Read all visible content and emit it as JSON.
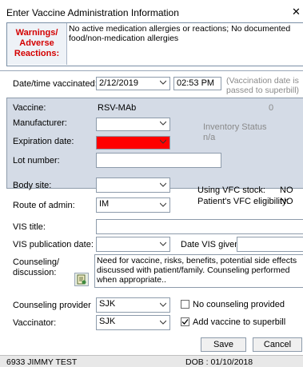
{
  "window": {
    "title": "Enter Vaccine Administration Information",
    "close": "✕"
  },
  "warnings": {
    "label": "Warnings/ Adverse Reactions:",
    "text": "No active medication allergies or reactions; No documented food/non-medication allergies"
  },
  "datetime": {
    "label": "Date/time vaccinated:",
    "date": "2/12/2019",
    "time": "02:53 PM",
    "note": "(Vaccination date is passed to superbill)"
  },
  "vaccine": {
    "label": "Vaccine:",
    "value": "RSV-MAb",
    "count": "0",
    "manufacturer_label": "Manufacturer:",
    "manufacturer": "",
    "expiration_label": "Expiration date:",
    "expiration": "",
    "inventory_label": "Inventory Status",
    "inventory_value": "n/a",
    "lot_label": "Lot number:",
    "lot": ""
  },
  "admin": {
    "body_site_label": "Body site:",
    "body_site": "",
    "route_label": "Route of admin:",
    "route": "IM",
    "vfc_stock_label": "Using VFC stock:",
    "vfc_stock": "NO",
    "vfc_elig_label": "Patient's VFC eligibility:",
    "vfc_elig": "NO"
  },
  "vis": {
    "title_label": "VIS title:",
    "title": "",
    "pub_label": "VIS publication date:",
    "pub": "",
    "given_label": "Date VIS given:",
    "given": ""
  },
  "counseling": {
    "label": "Counseling/ discussion:",
    "text": "Need for vaccine, risks, benefits, potential side effects discussed with patient/family. Counseling performed when appropriate..",
    "provider_label": "Counseling provider",
    "provider": "SJK",
    "no_counseling": "No counseling provided"
  },
  "vaccinator": {
    "label": "Vaccinator:",
    "value": "SJK",
    "add_superbill": "Add vaccine to superbill"
  },
  "buttons": {
    "save": "Save",
    "cancel": "Cancel"
  },
  "footer": {
    "patient": "6933 JIMMY TEST",
    "dob": "DOB : 01/10/2018"
  }
}
